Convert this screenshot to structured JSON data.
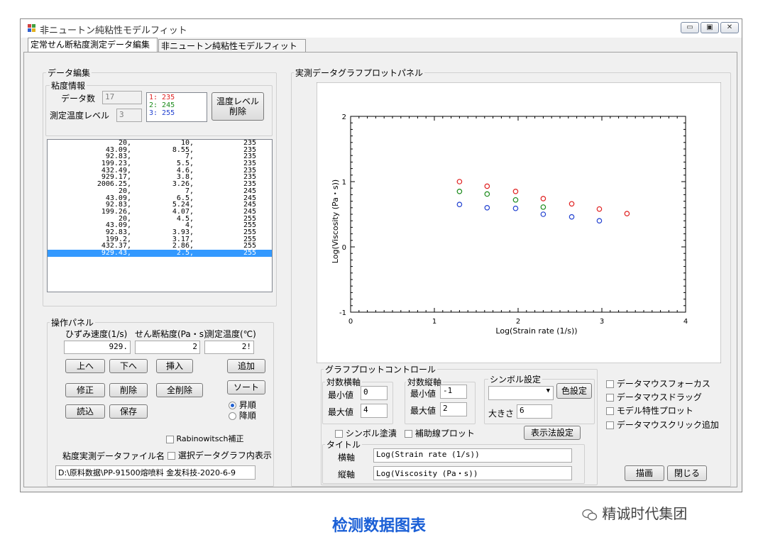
{
  "window": {
    "title": "非ニュートン純粘性モデルフィット",
    "buttons": [
      "▭",
      "▣",
      "✕"
    ]
  },
  "tabs": [
    {
      "label": "定常せん断粘度測定データ編集"
    },
    {
      "label": "非ニュートン純粘性モデルフィット"
    }
  ],
  "data_edit": {
    "group_label": "データ編集",
    "viscosity_info": {
      "label": "粘度情報",
      "count_label": "データ数",
      "count_value": "17",
      "temp_level_label": "測定温度レベル",
      "temp_level_value": "3",
      "levels": [
        {
          "text": "1: 235",
          "color": "#e02020"
        },
        {
          "text": "2: 245",
          "color": "#1a8a1a"
        },
        {
          "text": "3: 255",
          "color": "#2040d0"
        }
      ],
      "delete_button": "温度レベル\n削除"
    },
    "rows": [
      [
        "20,",
        "10,",
        "235"
      ],
      [
        "43.09,",
        "8.55,",
        "235"
      ],
      [
        "92.83,",
        "7,",
        "235"
      ],
      [
        "199.23,",
        "5.5,",
        "235"
      ],
      [
        "432.49,",
        "4.6,",
        "235"
      ],
      [
        "929.17,",
        "3.8,",
        "235"
      ],
      [
        "2006.25,",
        "3.26,",
        "235"
      ],
      [
        "20,",
        "7,",
        "245"
      ],
      [
        "43.09,",
        "6.5,",
        "245"
      ],
      [
        "92.83,",
        "5.24,",
        "245"
      ],
      [
        "199.26,",
        "4.07,",
        "245"
      ],
      [
        "20,",
        "4.5,",
        "255"
      ],
      [
        "43.09,",
        "4,",
        "255"
      ],
      [
        "92.83,",
        "3.93,",
        "255"
      ],
      [
        "199.2,",
        "3.17,",
        "255"
      ],
      [
        "432.37,",
        "2.86,",
        "255"
      ],
      [
        "929.43,",
        "2.5,",
        "255"
      ]
    ],
    "selected_row": 16
  },
  "operation_panel": {
    "label": "操作パネル",
    "col_strain": "ひずみ速度(1/s)",
    "col_visc": "せん断粘度(Pa・s)",
    "col_temp": "測定温度(℃)",
    "val_strain": "929.",
    "val_visc": "2",
    "val_temp": "2!",
    "btn_up": "上へ",
    "btn_down": "下へ",
    "btn_insert": "挿入",
    "btn_add": "追加",
    "btn_modify": "修正",
    "btn_delete": "削除",
    "btn_delete_all": "全削除",
    "btn_sort": "ソート",
    "btn_load": "読込",
    "btn_save": "保存",
    "radio_asc": "昇順",
    "radio_desc": "降順",
    "rabinowitsch": "Rabinowitsch補正",
    "file_label": "粘度実測データファイル名",
    "show_selected": "選択データグラフ内表示",
    "file_path": "D:\\原料数据\\PP-91500熔喷料 金发科技-2020-6-9"
  },
  "plot_panel": {
    "label": "実測データグラフプロットパネル"
  },
  "chart_data": {
    "type": "scatter",
    "xlabel": "Log(Strain rate (1/s))",
    "ylabel": "Log(Viscosity (Pa・s))",
    "xlim": [
      0,
      4
    ],
    "ylim": [
      -1,
      2
    ],
    "xticks": [
      "0",
      "1",
      "2",
      "3",
      "4"
    ],
    "yticks": [
      "-1",
      "0",
      "1",
      "2"
    ],
    "series": [
      {
        "color": "#e02020",
        "x": [
          1.3,
          1.63,
          1.97,
          2.3,
          2.64,
          2.97,
          3.3
        ],
        "y": [
          1.0,
          0.93,
          0.85,
          0.74,
          0.66,
          0.58,
          0.51
        ]
      },
      {
        "color": "#1a8a1a",
        "x": [
          1.3,
          1.63,
          1.97,
          2.3
        ],
        "y": [
          0.85,
          0.81,
          0.72,
          0.61
        ]
      },
      {
        "color": "#2040d0",
        "x": [
          1.3,
          1.63,
          1.97,
          2.3,
          2.64,
          2.97
        ],
        "y": [
          0.65,
          0.6,
          0.59,
          0.5,
          0.46,
          0.4
        ]
      }
    ]
  },
  "graph_control": {
    "label": "グラフプロットコントロール",
    "xaxis_label": "対数横軸",
    "yaxis_label": "対数縦軸",
    "min_label": "最小値",
    "max_label": "最大値",
    "x_min": "0",
    "x_max": "4",
    "y_min": "-1",
    "y_max": "2",
    "symbol_label": "シンボル設定",
    "color_button": "色設定",
    "size_label": "大きさ",
    "size_value": "6",
    "fill_symbol": "シンボル塗潰",
    "aux_plot": "補助線プロット",
    "display_button": "表示法設定",
    "title_group": "タイトル",
    "h_axis_label": "横軸",
    "v_axis_label": "縦軸",
    "h_axis_value": "Log(Strain rate (1/s))",
    "v_axis_value": "Log(Viscosity (Pa・s))",
    "mouse_focus": "データマウスフォーカス",
    "mouse_drag": "データマウスドラッグ",
    "model_plot": "モデル特性プロット",
    "mouse_click_add": "データマウスクリック追加",
    "draw_button": "描画",
    "close_button": "閉じる"
  },
  "caption": "检测数据图表",
  "watermark": "精诚时代集团"
}
